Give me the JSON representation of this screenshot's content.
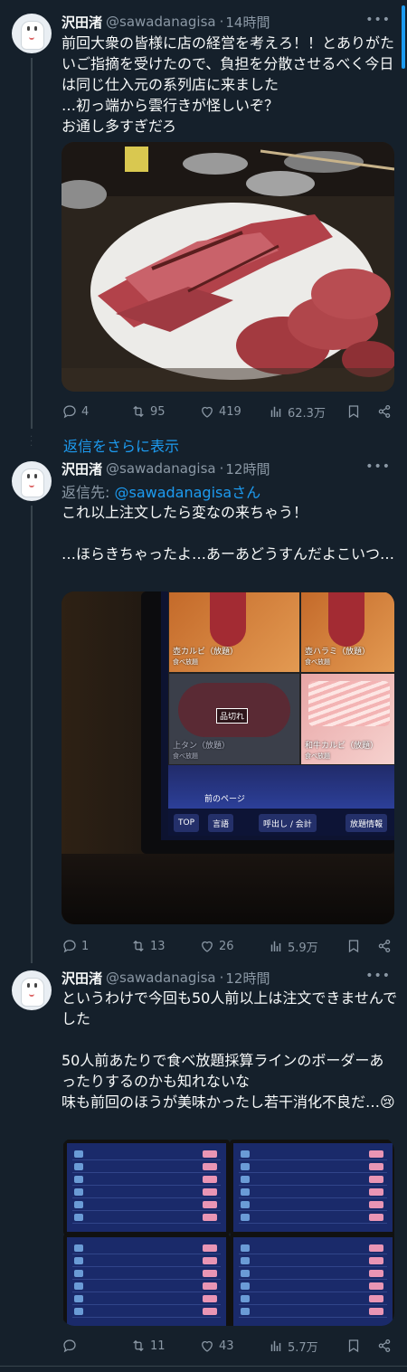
{
  "tweets": [
    {
      "name": "沢田渚",
      "handle": "@sawadanagisa",
      "time": "14時間",
      "text": "前回大衆の皆様に店の経営を考えろ！！とありがたいご指摘を受けたので、負担を分散させるべく今日は同じ仕入元の系列店に来ました\n…初っ端から雲行きが怪しいぞ？\nお通し多すぎだろ",
      "stats": {
        "replies": "4",
        "retweets": "95",
        "likes": "419",
        "views": "62.3万"
      }
    },
    {
      "name": "沢田渚",
      "handle": "@sawadanagisa",
      "time": "12時間",
      "reply_prefix": "返信先: ",
      "reply_handle": "@sawadanagisaさん",
      "text": "これ以上注文したら変なの来ちゃう！\n\n…ほらきちゃったよ…あーあどうすんだよこいつ…",
      "tablet": {
        "items": [
          {
            "name": "壺カルビ（放題）",
            "sub": "食べ放題"
          },
          {
            "name": "壺ハラミ（放題）",
            "sub": "食べ放題"
          },
          {
            "name": "上タン（放題）",
            "sub": "食べ放題",
            "badge": "品切れ"
          },
          {
            "name": "和牛カルビ（放題）",
            "sub": "食べ放題"
          }
        ],
        "prev_page": "前のページ",
        "buttons": [
          "TOP",
          "言語",
          "呼出し / 会計",
          "放題情報"
        ]
      },
      "stats": {
        "replies": "1",
        "retweets": "13",
        "likes": "26",
        "views": "5.9万"
      }
    },
    {
      "name": "沢田渚",
      "handle": "@sawadanagisa",
      "time": "12時間",
      "text": "というわけで今回も50人前以上は注文できませんでした\n\n50人前あたりで食べ放題採算ラインのボーダーあったりするのかも知れないな\n味も前回のほうが美味かったし若干消化不良だ…😢",
      "stats": {
        "replies": "",
        "retweets": "11",
        "likes": "43",
        "views": "5.7万"
      }
    }
  ],
  "show_more": "返信をさらに表示",
  "colors": {
    "background": "#15202b",
    "accent": "#1d9bf0",
    "muted": "#8b98a5",
    "divider": "#38444d"
  }
}
